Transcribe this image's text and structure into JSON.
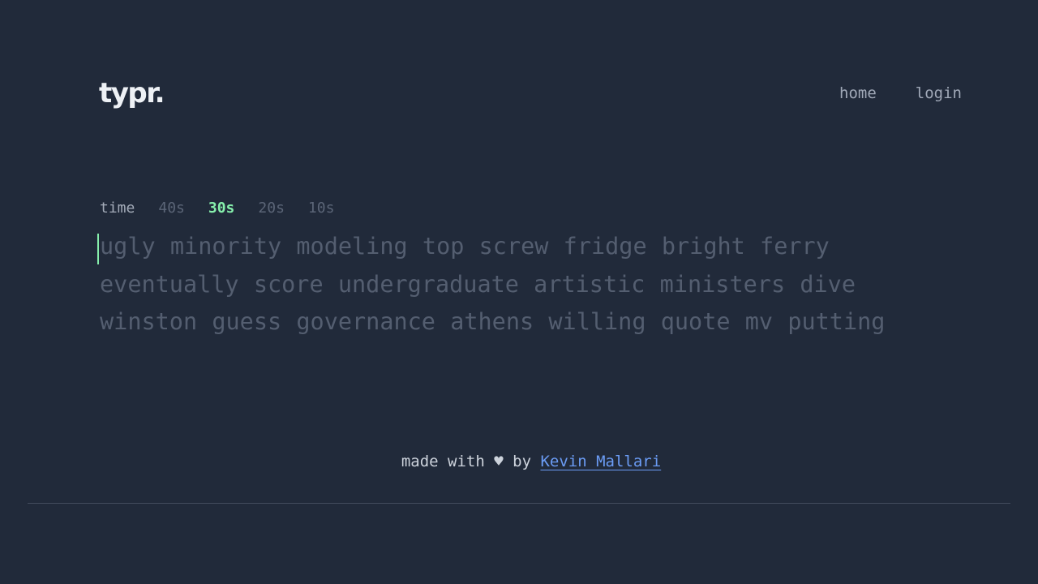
{
  "header": {
    "logo": "typr.",
    "nav": [
      "home",
      "login"
    ]
  },
  "timer": {
    "label": "time",
    "options": [
      "40s",
      "30s",
      "20s",
      "10s"
    ],
    "selected": "30s"
  },
  "words": [
    "ugly",
    "minority",
    "modeling",
    "top",
    "screw",
    "fridge",
    "bright",
    "ferry",
    "eventually",
    "score",
    "undergraduate",
    "artistic",
    "ministers",
    "dive",
    "winston",
    "guess",
    "governance",
    "athens",
    "willing",
    "quote",
    "mv",
    "putting"
  ],
  "footer": {
    "prefix": "made with",
    "heart": "♥",
    "by": "by",
    "author": "Kevin Mallari"
  },
  "colors": {
    "background": "#212a3a",
    "accent": "#86efac",
    "link": "#6b9cf5"
  }
}
